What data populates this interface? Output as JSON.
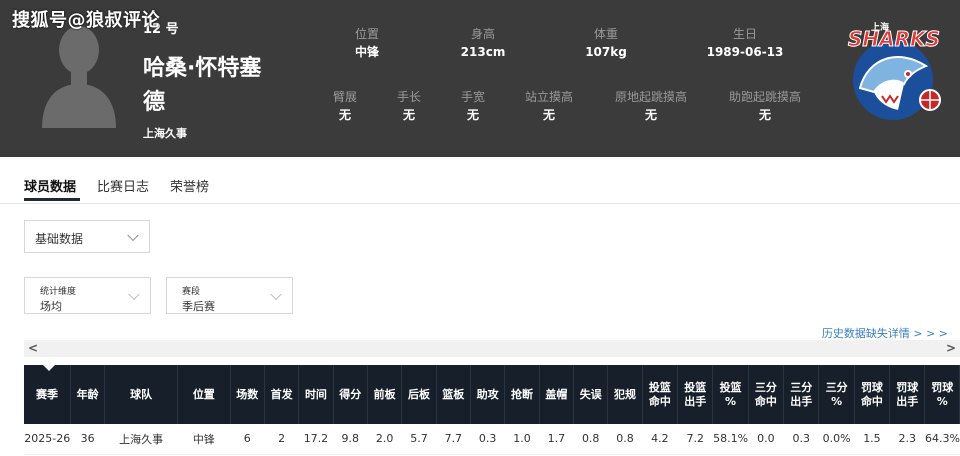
{
  "watermark": "搜狐号@狼叔评论",
  "player": {
    "number": "12 号",
    "name": "哈桑·怀特塞德",
    "team": "上海久事"
  },
  "stats_top": [
    {
      "label": "位置",
      "value": "中锋"
    },
    {
      "label": "身高",
      "value": "213cm"
    },
    {
      "label": "体重",
      "value": "107kg"
    },
    {
      "label": "生日",
      "value": "1989-06-13"
    }
  ],
  "stats_bottom": [
    {
      "label": "臂展",
      "value": "无"
    },
    {
      "label": "手长",
      "value": "无"
    },
    {
      "label": "手宽",
      "value": "无"
    },
    {
      "label": "站立摸高",
      "value": "无"
    },
    {
      "label": "原地起跳摸高",
      "value": "无"
    },
    {
      "label": "助跑起跳摸高",
      "value": "无"
    }
  ],
  "logo": {
    "top_text": "上海",
    "word": "SHARKS",
    "icon": "shark-logo-icon"
  },
  "tabs": [
    {
      "label": "球员数据",
      "active": true
    },
    {
      "label": "比赛日志",
      "active": false
    },
    {
      "label": "荣誉榜",
      "active": false
    }
  ],
  "filters": {
    "data_type": "基础数据",
    "dimension_label": "统计维度",
    "dimension_value": "场均",
    "phase_label": "赛段",
    "phase_value": "季后赛"
  },
  "history_link": "历史数据缺失详情 > > >",
  "scroll": {
    "left": "<",
    "right": ">"
  },
  "table": {
    "headers": [
      "赛季",
      "年龄",
      "球队",
      "位置",
      "场数",
      "首发",
      "时间",
      "得分",
      "前板",
      "后板",
      "篮板",
      "助攻",
      "抢断",
      "盖帽",
      "失误",
      "犯规",
      "投篮\n命中",
      "投篮\n出手",
      "投篮\n%",
      "三分\n命中",
      "三分\n出手",
      "三分\n%",
      "罚球\n命中",
      "罚球\n出手",
      "罚球\n%"
    ],
    "rows": [
      [
        "2025-26",
        "36",
        "上海久事",
        "中锋",
        "6",
        "2",
        "17.2",
        "9.8",
        "2.0",
        "5.7",
        "7.7",
        "0.3",
        "1.0",
        "1.7",
        "0.8",
        "0.8",
        "4.2",
        "7.2",
        "58.1%",
        "0.0",
        "0.3",
        "0.0%",
        "1.5",
        "2.3",
        "64.3%"
      ]
    ]
  },
  "colors": {
    "header_bg": "#3b3b3b",
    "table_header_bg": "#17202a",
    "link": "#3b7fc4"
  }
}
